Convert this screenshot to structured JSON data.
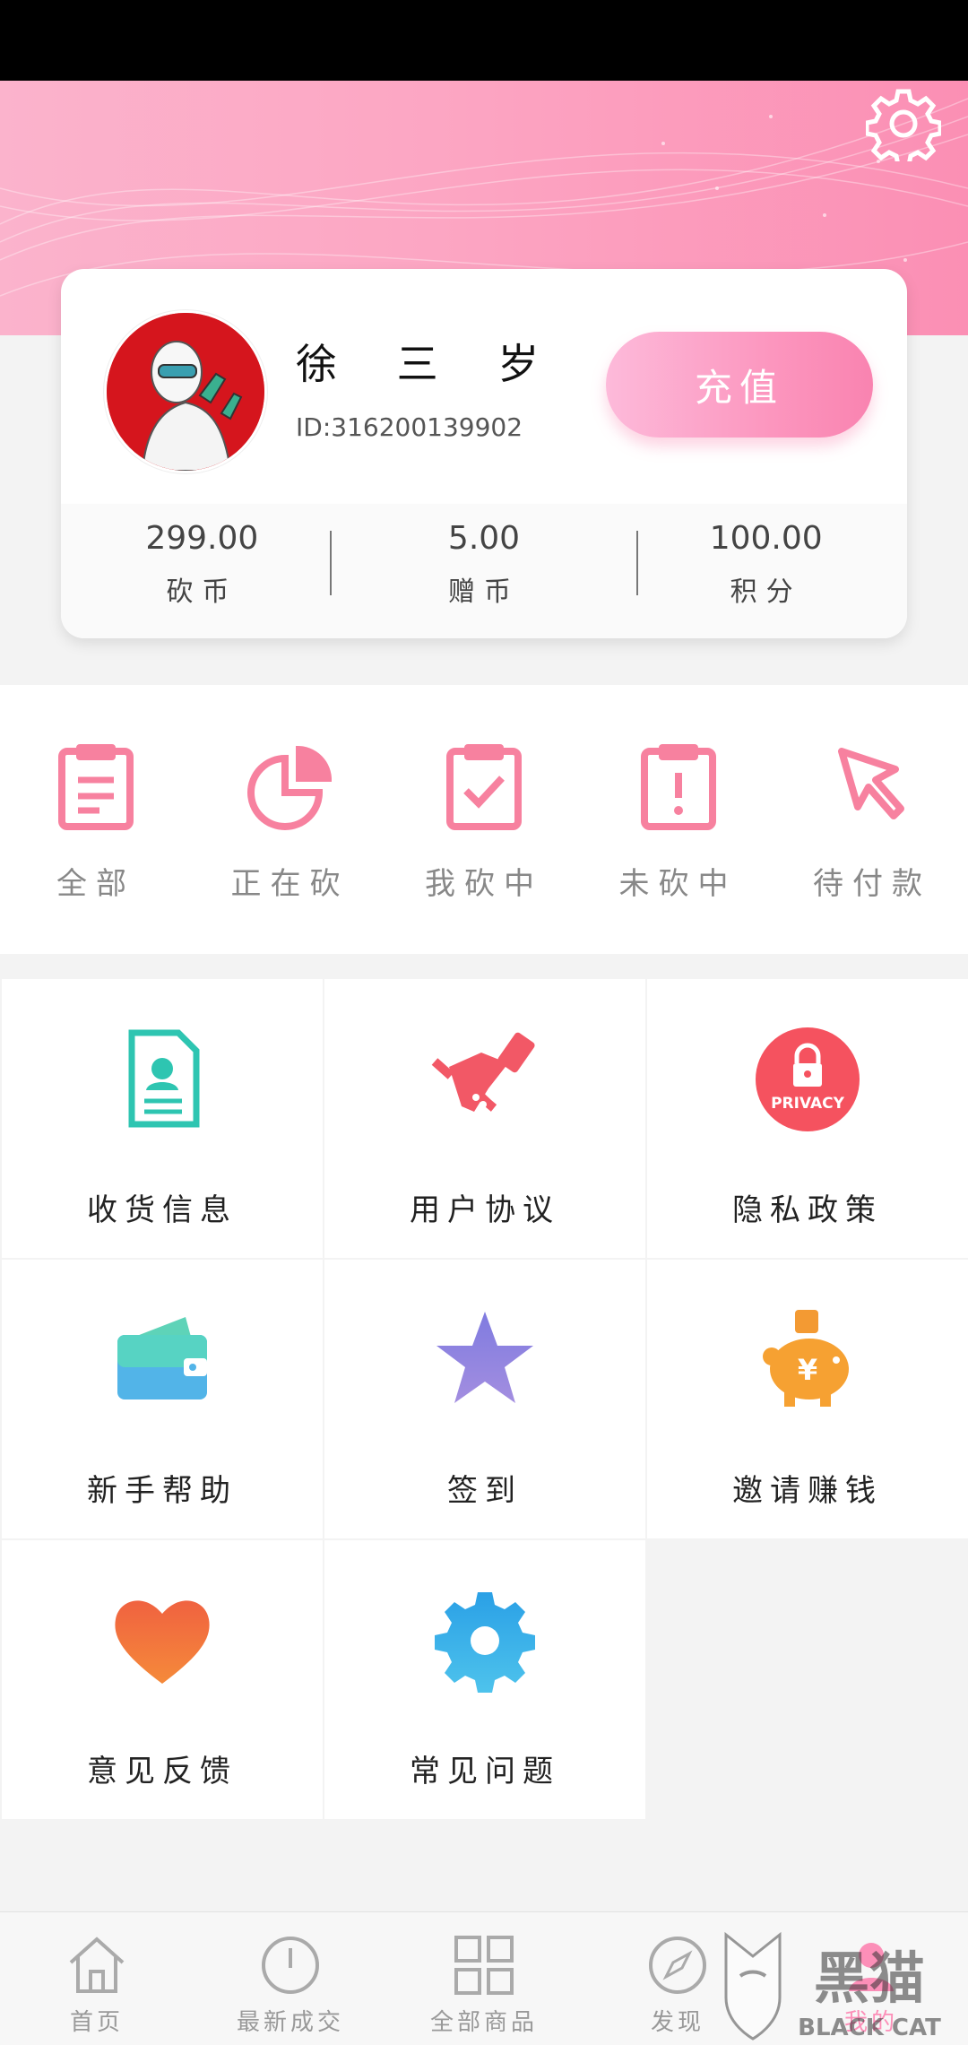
{
  "profile": {
    "name": "徐 三 岁",
    "id_text": "ID:316200139902",
    "recharge_label": "充值"
  },
  "stats": [
    {
      "value": "299.00",
      "label": "砍币"
    },
    {
      "value": "5.00",
      "label": "赠币"
    },
    {
      "value": "100.00",
      "label": "积分"
    }
  ],
  "orders": [
    {
      "label": "全部",
      "icon": "clipboard-icon"
    },
    {
      "label": "正在砍",
      "icon": "pie-chart-icon"
    },
    {
      "label": "我砍中",
      "icon": "clipboard-check-icon"
    },
    {
      "label": "未砍中",
      "icon": "clipboard-alert-icon"
    },
    {
      "label": "待付款",
      "icon": "cursor-arrow-icon"
    }
  ],
  "services": [
    {
      "label": "收货信息",
      "icon": "address-card-icon"
    },
    {
      "label": "用户协议",
      "icon": "handshake-icon"
    },
    {
      "label": "隐私政策",
      "icon": "privacy-lock-icon",
      "badge_text": "PRIVACY"
    },
    {
      "label": "新手帮助",
      "icon": "wallet-icon"
    },
    {
      "label": "签到",
      "icon": "star-icon"
    },
    {
      "label": "邀请赚钱",
      "icon": "piggy-bank-icon",
      "symbol": "¥"
    },
    {
      "label": "意见反馈",
      "icon": "heart-icon"
    },
    {
      "label": "常见问题",
      "icon": "gear-icon"
    }
  ],
  "tabbar": [
    {
      "label": "首页",
      "icon": "home-icon"
    },
    {
      "label": "最新成交",
      "icon": "clock-icon"
    },
    {
      "label": "全部商品",
      "icon": "grid-icon"
    },
    {
      "label": "发现",
      "icon": "compass-icon"
    },
    {
      "label": "我的",
      "icon": "user-icon"
    }
  ],
  "watermark": {
    "text_cn": "黑猫",
    "text_en": "BLACK CAT"
  },
  "colors": {
    "accent_pink": "#fc8fb8",
    "order_icon_pink": "#f7819f",
    "avatar_red": "#d5151d",
    "hero_pink": "#fca6c3"
  }
}
